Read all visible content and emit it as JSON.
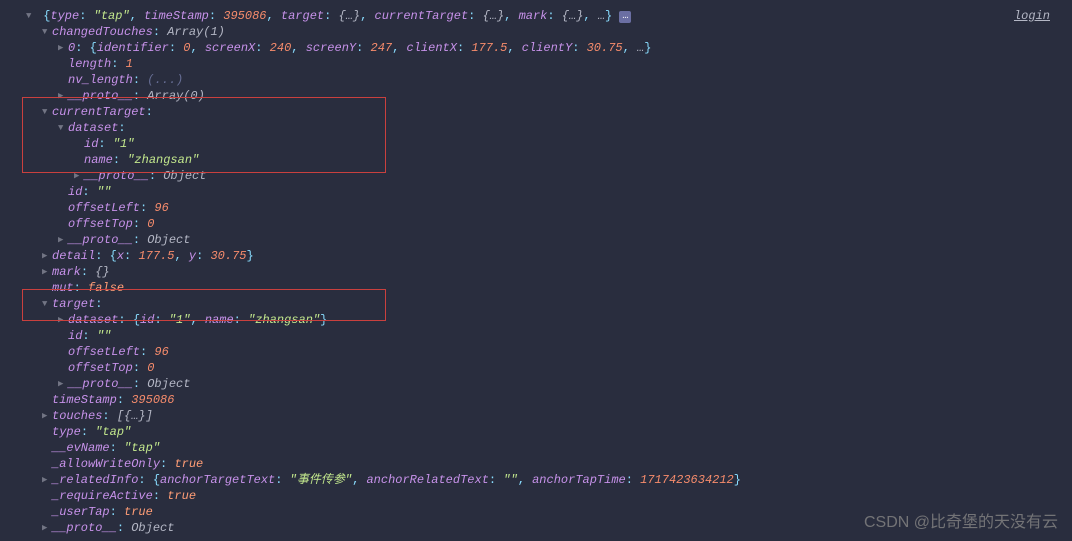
{
  "login": "login",
  "watermark": "CSDN @比奇堡的天没有云",
  "root": {
    "typeKey": "type",
    "typeVal": "\"tap\"",
    "timeStampKey": "timeStamp",
    "timeStampVal": "395086",
    "targetKey": "target",
    "targetVal": "{…}",
    "currentTargetKey": "currentTarget",
    "currentTargetVal": "{…}",
    "markKey": "mark",
    "markVal": "{…}",
    "trail": "…"
  },
  "changedTouches": {
    "key": "changedTouches",
    "preview": "Array(1)",
    "zero": {
      "idx": "0",
      "identifierKey": "identifier",
      "identifierVal": "0",
      "screenXKey": "screenX",
      "screenXVal": "240",
      "screenYKey": "screenY",
      "screenYVal": "247",
      "clientXKey": "clientX",
      "clientXVal": "177.5",
      "clientYKey": "clientY",
      "clientYVal": "30.75",
      "trail": "…"
    },
    "lengthKey": "length",
    "lengthVal": "1",
    "nvlenKey": "nv_length",
    "nvlenVal": "(...)",
    "protoKey": "__proto__",
    "protoVal": "Array(0)"
  },
  "currentTarget": {
    "key": "currentTarget",
    "datasetKey": "dataset",
    "idKey": "id",
    "idVal": "\"1\"",
    "nameKey": "name",
    "nameVal": "\"zhangsan\"",
    "protoKey": "__proto__",
    "protoVal": "Object",
    "id2Key": "id",
    "id2Val": "\"\"",
    "offLeftKey": "offsetLeft",
    "offLeftVal": "96",
    "offTopKey": "offsetTop",
    "offTopVal": "0",
    "proto2Key": "__proto__",
    "proto2Val": "Object"
  },
  "detail": {
    "key": "detail",
    "xKey": "x",
    "xVal": "177.5",
    "yKey": "y",
    "yVal": "30.75"
  },
  "mark": {
    "key": "mark",
    "val": "{}"
  },
  "mut": {
    "key": "mut",
    "val": "false"
  },
  "target": {
    "key": "target",
    "datasetKey": "dataset",
    "datasetIdKey": "id",
    "datasetIdVal": "\"1\"",
    "datasetNameKey": "name",
    "datasetNameVal": "\"zhangsan\"",
    "idKey": "id",
    "idVal": "\"\"",
    "offLeftKey": "offsetLeft",
    "offLeftVal": "96",
    "offTopKey": "offsetTop",
    "offTopVal": "0",
    "protoKey": "__proto__",
    "protoVal": "Object"
  },
  "timeStamp": {
    "key": "timeStamp",
    "val": "395086"
  },
  "touches": {
    "key": "touches",
    "val": "[{…}]"
  },
  "type": {
    "key": "type",
    "val": "\"tap\""
  },
  "evName": {
    "key": "__evName",
    "val": "\"tap\""
  },
  "allowWrite": {
    "key": "_allowWriteOnly",
    "val": "true"
  },
  "relatedInfo": {
    "key": "_relatedInfo",
    "anchorTargetTextKey": "anchorTargetText",
    "anchorTargetTextVal": "\"事件传参\"",
    "anchorRelatedTextKey": "anchorRelatedText",
    "anchorRelatedTextVal": "\"\"",
    "anchorTapTimeKey": "anchorTapTime",
    "anchorTapTimeVal": "1717423634212"
  },
  "requireActive": {
    "key": "_requireActive",
    "val": "true"
  },
  "userTap": {
    "key": "_userTap",
    "val": "true"
  },
  "protoLast": {
    "key": "__proto__",
    "val": "Object"
  }
}
